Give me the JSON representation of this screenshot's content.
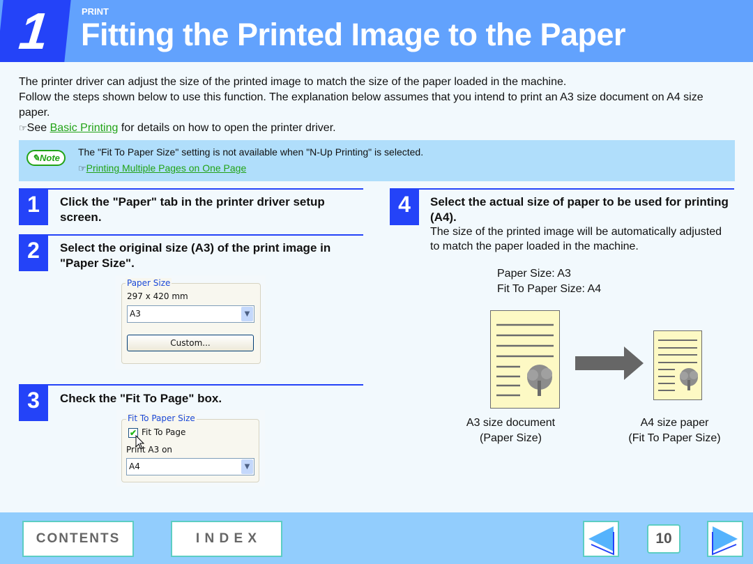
{
  "header": {
    "chapter_number": "1",
    "section": "PRINT",
    "title": "Fitting the Printed Image to the Paper"
  },
  "intro": {
    "line1": "The printer driver can adjust the size of the printed image to match the size of the paper loaded in the machine.",
    "line2": "Follow the steps shown below to use this function. The explanation below assumes that you intend to print an A3 size document on A4 size paper.",
    "see_prefix": "See ",
    "see_link": "Basic Printing",
    "see_suffix": " for details on how to open the printer driver.",
    "ref_icon": "☞"
  },
  "note": {
    "badge": "Note",
    "text": "The \"Fit To Paper Size\" setting is not available when \"N-Up Printing\" is selected.",
    "link": "Printing Multiple Pages on One Page",
    "ref_icon": "☞"
  },
  "steps": [
    {
      "number": "1",
      "title": "Click the \"Paper\" tab in the printer driver setup screen."
    },
    {
      "number": "2",
      "title": "Select the original size (A3) of the print image in \"Paper Size\"."
    },
    {
      "number": "3",
      "title": "Check the \"Fit To Page\" box."
    },
    {
      "number": "4",
      "title": "Select the actual size of paper to be used for printing (A4).",
      "description": "The size of the printed image will be automatically adjusted to match the paper loaded in the machine."
    }
  ],
  "paper_size_dialog": {
    "group_label": "Paper Size",
    "dimensions": "297 x 420 mm",
    "selected": "A3",
    "custom_button": "Custom..."
  },
  "fit_dialog": {
    "group_label": "Fit To Paper Size",
    "checkbox_label": "Fit To Page",
    "checkbox_checked": true,
    "print_on_label": "Print A3 on",
    "selected": "A4"
  },
  "illustration": {
    "paper_size_line": "Paper Size: A3",
    "fit_size_line": "Fit To Paper Size: A4",
    "left_caption_1": "A3 size document",
    "left_caption_2": "(Paper Size)",
    "right_caption_1": "A4 size paper",
    "right_caption_2": "(Fit To Paper Size)"
  },
  "footer": {
    "contents": "CONTENTS",
    "index": "I N D E X",
    "page_number": "10"
  },
  "colors": {
    "header_blue": "#62a2fd",
    "step_blue": "#2443f8",
    "link_green": "#22a316",
    "note_bg": "#b0defb",
    "footer_bg": "#92cdfd"
  }
}
